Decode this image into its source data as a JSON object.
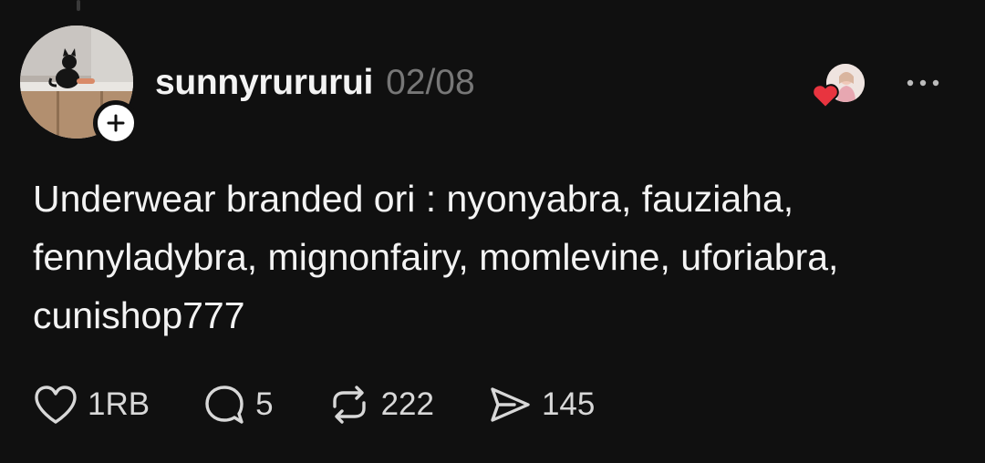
{
  "post": {
    "username": "sunnyrururui",
    "timestamp": "02/08",
    "text": "Underwear branded ori : nyonyabra, fauziaha, fennyladybra, mignonfairy, momlevine, uforiabra, cunishop777",
    "icons": {
      "avatar": "cat-photo-avatar",
      "follow": "plus-icon",
      "liker": "liker-avatar-heart",
      "more": "more-horizontal-icon"
    }
  },
  "actions": {
    "like_count": "1RB",
    "comment_count": "5",
    "repost_count": "222",
    "share_count": "145",
    "icons": [
      "heart-icon",
      "comment-icon",
      "repost-icon",
      "send-icon"
    ]
  },
  "colors": {
    "background": "#101010",
    "text": "#f3f3f3",
    "muted": "#777777",
    "heart": "#e8343f"
  }
}
